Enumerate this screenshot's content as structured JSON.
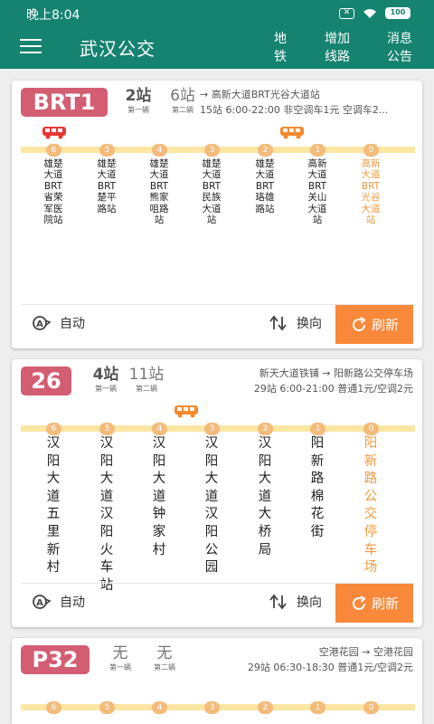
{
  "status_bar": {
    "time": "晚上8:04",
    "battery": "100",
    "notif_icon": "close-box-icon",
    "wifi_icon": "wifi-icon"
  },
  "app_bar": {
    "title": "武汉公交",
    "nav": [
      {
        "line1": "地",
        "line2": "铁"
      },
      {
        "line1": "增加",
        "line2": "线路"
      },
      {
        "line1": "消息",
        "line2": "公告"
      }
    ]
  },
  "colors": {
    "primary": "#15836f",
    "badge": "#d35d72",
    "accent": "#f8883a",
    "highlight": "#ee9a3f",
    "track": "#fbe6a4",
    "dot": "#f3bb7c"
  },
  "cards": [
    {
      "line": "BRT1",
      "first_count": "2站",
      "first_label": "第一辆",
      "second_count": "6站",
      "second_label": "第二辆",
      "route": "→ 高新大道BRT光谷大道站",
      "info": "15站  6:00-22:00  非空调车1元 空调车2...",
      "stops": [
        {
          "num": "6",
          "name": "雄楚大道BRT省荣军医院站"
        },
        {
          "num": "5",
          "name": "雄楚大道BRT楚平路站"
        },
        {
          "num": "4",
          "name": "雄楚大道BRT熊家咀路站"
        },
        {
          "num": "3",
          "name": "雄楚大道BRT民族大道站"
        },
        {
          "num": "2",
          "name": "雄楚大道BRT珞雄路站"
        },
        {
          "num": "1",
          "name": "高新大道BRT关山大道站"
        },
        {
          "num": "0",
          "name": "高新大道BRT光谷大道站"
        }
      ],
      "auto_label": "自动",
      "switch_label": "换向",
      "refresh_label": "刷新"
    },
    {
      "line": "26",
      "first_count": "4站",
      "first_label": "第一辆",
      "second_count": "11站",
      "second_label": "第二辆",
      "route": "新天大道铁铺 → 阳新路公交停车场",
      "info": "29站  6:00-21:00  普通1元/空调2元",
      "stops": [
        {
          "num": "6",
          "name": "汉阳大道五里新村"
        },
        {
          "num": "5",
          "name": "汉阳大道汉阳火车站"
        },
        {
          "num": "4",
          "name": "汉阳大道钟家村"
        },
        {
          "num": "3",
          "name": "汉阳大道汉阳公园"
        },
        {
          "num": "2",
          "name": "汉阳大道大桥局"
        },
        {
          "num": "1",
          "name": "阳新路棉花街"
        },
        {
          "num": "0",
          "name": "阳新路公交停车场"
        }
      ],
      "auto_label": "自动",
      "switch_label": "换向",
      "refresh_label": "刷新"
    },
    {
      "line": "P32",
      "first_count": "无",
      "first_label": "第一辆",
      "second_count": "无",
      "second_label": "第二辆",
      "route": "空港花园 → 空港花园",
      "info": "29站  06:30-18:30  普通1元/空调2元",
      "stops": [
        {
          "num": "6"
        },
        {
          "num": "5"
        },
        {
          "num": "4"
        },
        {
          "num": "3"
        },
        {
          "num": "2"
        },
        {
          "num": "1"
        },
        {
          "num": "0"
        }
      ]
    }
  ]
}
